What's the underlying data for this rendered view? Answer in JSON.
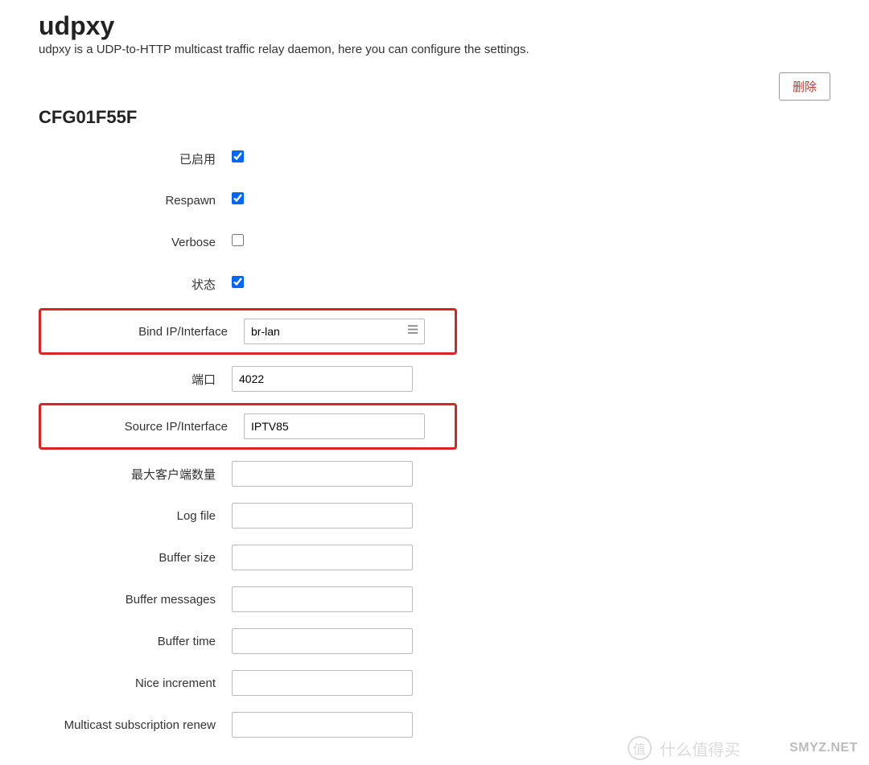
{
  "header": {
    "title": "udpxy",
    "subtitle": "udpxy is a UDP-to-HTTP multicast traffic relay daemon, here you can configure the settings."
  },
  "actions": {
    "delete_label": "删除"
  },
  "section": {
    "id": "CFG01F55F"
  },
  "fields": {
    "enabled": {
      "label": "已启用",
      "checked": true
    },
    "respawn": {
      "label": "Respawn",
      "checked": true
    },
    "verbose": {
      "label": "Verbose",
      "checked": false
    },
    "status": {
      "label": "状态",
      "checked": true
    },
    "bind_ip": {
      "label": "Bind IP/Interface",
      "value": "br-lan"
    },
    "port": {
      "label": "端口",
      "value": "4022"
    },
    "source_ip": {
      "label": "Source IP/Interface",
      "value": "IPTV85"
    },
    "max_clients": {
      "label": "最大客户端数量",
      "value": ""
    },
    "log_file": {
      "label": "Log file",
      "value": ""
    },
    "buffer_size": {
      "label": "Buffer size",
      "value": ""
    },
    "buffer_messages": {
      "label": "Buffer messages",
      "value": ""
    },
    "buffer_time": {
      "label": "Buffer time",
      "value": ""
    },
    "nice_increment": {
      "label": "Nice increment",
      "value": ""
    },
    "multicast_renew": {
      "label": "Multicast subscription renew",
      "value": ""
    }
  },
  "watermarks": {
    "w1_symbol": "值",
    "w1_text": "什么值得买",
    "w2_text": "SMYZ.NET"
  }
}
